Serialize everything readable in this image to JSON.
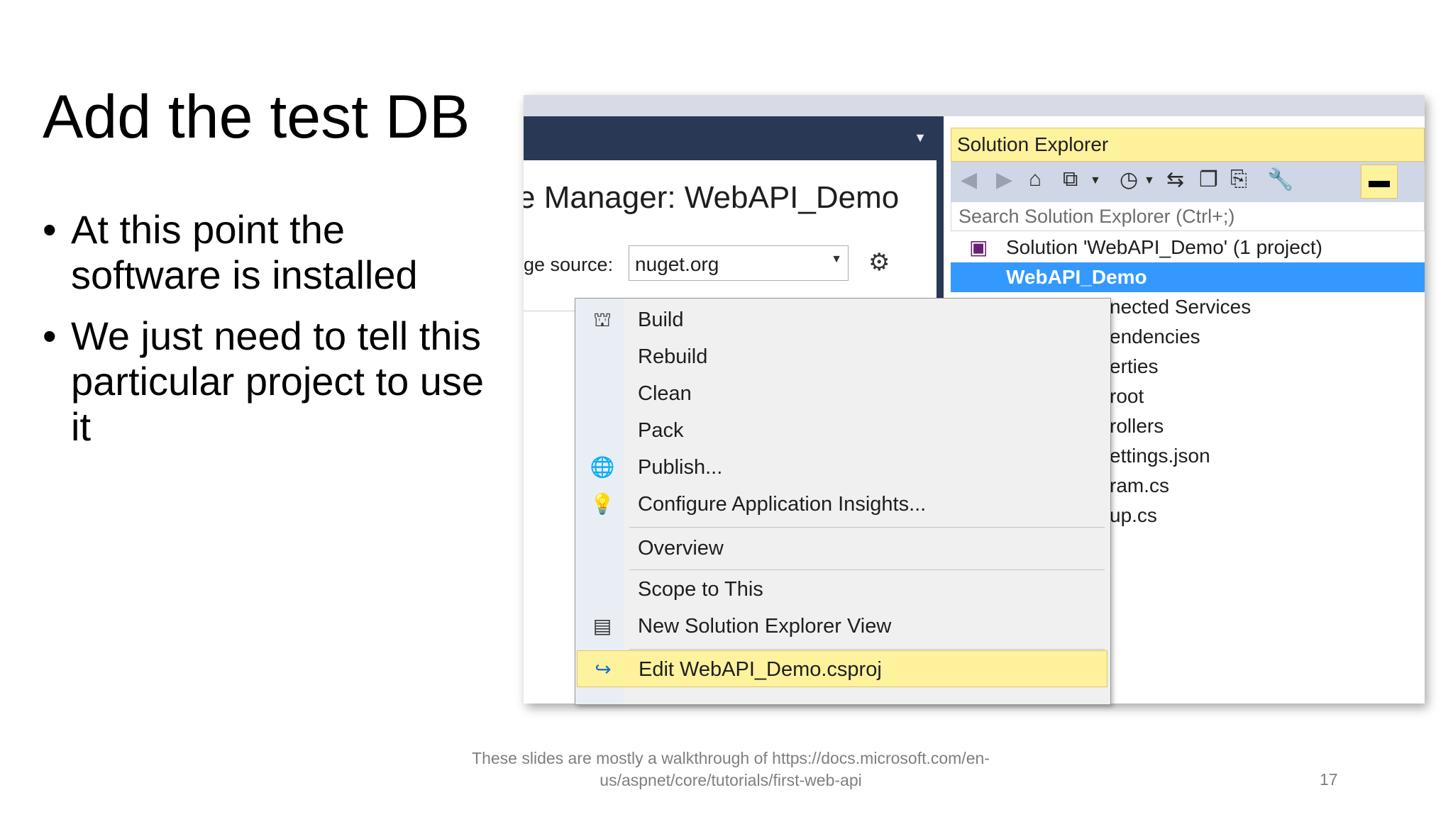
{
  "slide": {
    "title": "Add the test DB",
    "bullets": [
      "At this point the software is installed",
      "We just need to tell this particular project to use it"
    ],
    "footer_line1": "These slides are mostly a walkthrough of https://docs.microsoft.com/en-",
    "footer_line2": "us/aspnet/core/tutorials/first-web-api",
    "page_number": "17"
  },
  "vs": {
    "manager_title": "e Manager: WebAPI_Demo",
    "package_source_label": "ge source:",
    "package_source_value": "nuget.org",
    "solution_explorer": {
      "title": "Solution Explorer",
      "search_placeholder": "Search Solution Explorer (Ctrl+;)",
      "tree": [
        "Solution 'WebAPI_Demo' (1 project)",
        "WebAPI_Demo",
        "nected Services",
        "endencies",
        "erties",
        "root",
        "rollers",
        "ettings.json",
        "ram.cs",
        "up.cs"
      ]
    },
    "context_menu": [
      {
        "label": "Build",
        "icon": "build-icon"
      },
      {
        "label": "Rebuild",
        "icon": ""
      },
      {
        "label": "Clean",
        "icon": ""
      },
      {
        "label": "Pack",
        "icon": ""
      },
      {
        "label": "Publish...",
        "icon": "publish-globe-icon"
      },
      {
        "label": "Configure Application Insights...",
        "icon": "app-insights-icon"
      },
      {
        "label": "Overview",
        "icon": ""
      },
      {
        "label": "Scope to This",
        "icon": ""
      },
      {
        "label": "New Solution Explorer View",
        "icon": "new-view-icon"
      },
      {
        "label": "Edit WebAPI_Demo.csproj",
        "icon": "edit-arrow-icon"
      }
    ]
  },
  "colors": {
    "vs_dark": "#293955",
    "highlight_yellow": "#fff29d",
    "selection_blue": "#3399ff"
  }
}
